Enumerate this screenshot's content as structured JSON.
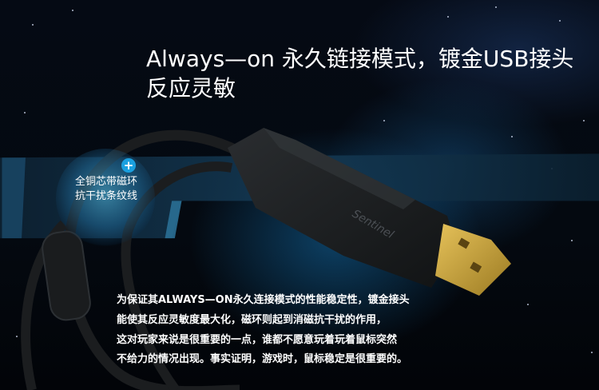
{
  "banner": {
    "line1": "Always—on 永久链接模式，镀金USB接头",
    "line2": "反应灵敏"
  },
  "callout": {
    "line1": "全铜芯带磁环",
    "line2": "抗干扰条纹线",
    "plus_symbol": "+"
  },
  "description": {
    "lines": [
      "为保证其ALWAYS—ON永久连接模式的性能稳定性，镀金接头",
      "能使其反应灵敏度最大化，磁环则起到消磁抗干扰的作用，",
      "这对玩家来说是很重要的一点，谁都不愿意玩着玩着鼠标突然",
      "不给力的情况出现。事实证明，游戏时，鼠标稳定是很重要的。"
    ]
  },
  "product": {
    "connector_label": "Sentinel",
    "colors": {
      "connector": "#1c1e20",
      "gold": "#c8a23a",
      "accent_blue": "#1aa0e0"
    }
  }
}
